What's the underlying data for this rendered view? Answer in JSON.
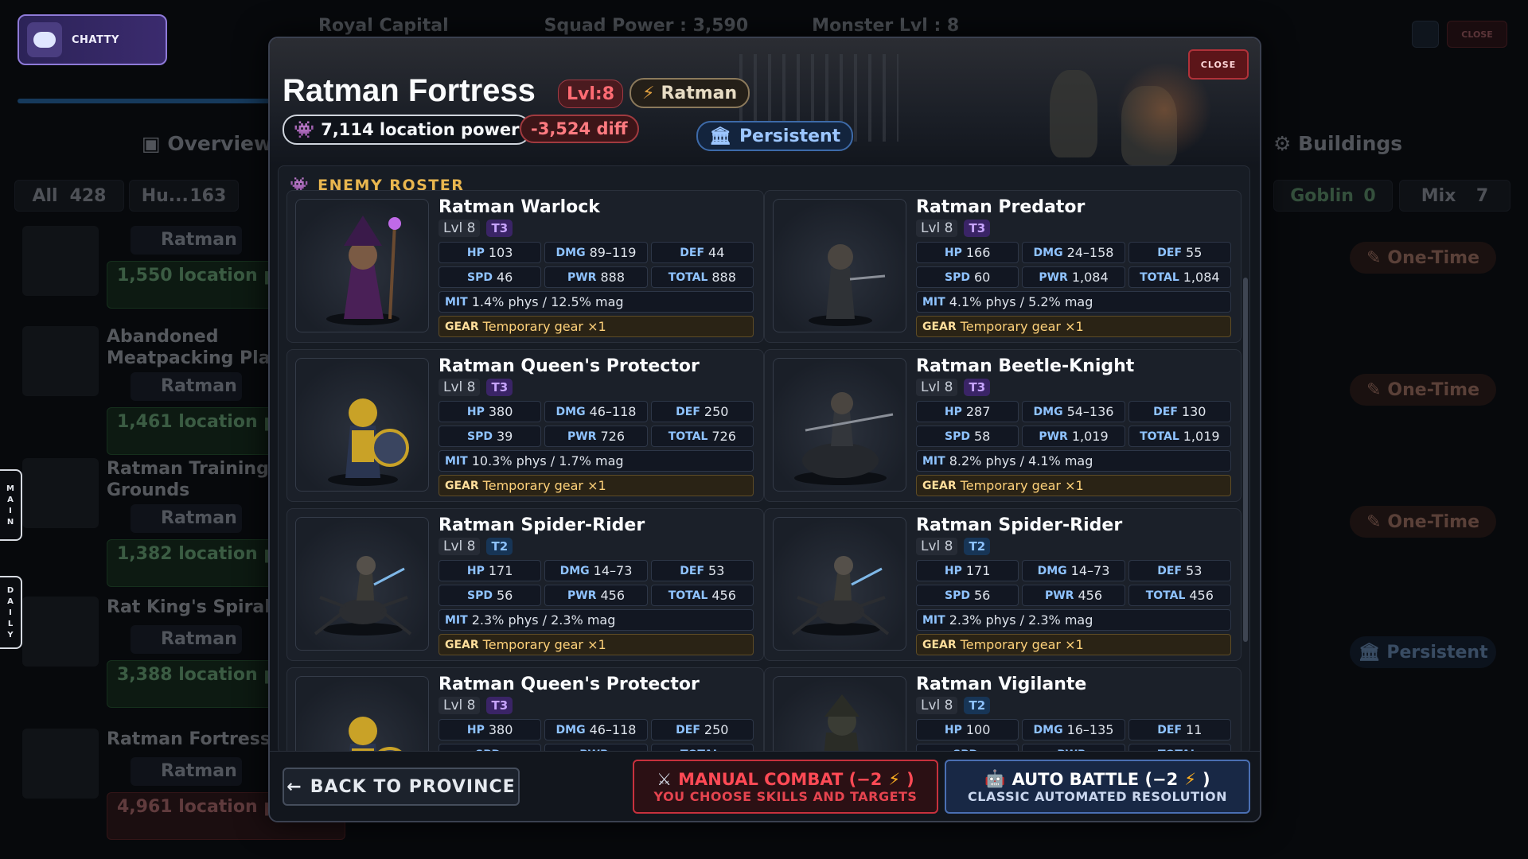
{
  "chat": {
    "label": "CHATTY"
  },
  "background": {
    "top": {
      "capital": "Royal Capital",
      "squad_power": "Squad Power : 3,590",
      "monster_lvl": "Monster Lvl : 8"
    },
    "tabs": {
      "overview": "Overview",
      "buildings": "Buildings"
    },
    "filters": [
      {
        "label": "All",
        "count": "428"
      },
      {
        "label": "Hu...",
        "count": "163"
      },
      {
        "label": "Goblin",
        "count": "0"
      },
      {
        "label": "Mix",
        "count": "7"
      }
    ],
    "locations": [
      {
        "name": "",
        "faction": "Ratman",
        "power": "1,550 location power",
        "tag": "One-Time"
      },
      {
        "name": "Abandoned Meatpacking Plant",
        "faction": "Ratman",
        "power": "1,461 location power",
        "tag": "One-Time"
      },
      {
        "name": "Ratman Training Grounds",
        "faction": "Ratman",
        "power": "1,382 location power",
        "tag": "One-Time"
      },
      {
        "name": "Rat King's Spiral",
        "faction": "Ratman",
        "power": "3,388 location power",
        "tag": "Persistent"
      },
      {
        "name": "Ratman Fortress",
        "faction": "Ratman",
        "power": "4,961 location power",
        "tag": ""
      }
    ],
    "side_tabs": {
      "main": [
        "M",
        "A",
        "I",
        "N"
      ],
      "daily": [
        "D",
        "A",
        "I",
        "L",
        "Y"
      ]
    },
    "window": {
      "close_label": "CLOSE"
    }
  },
  "modal": {
    "title": "Ratman Fortress",
    "level": "Lvl:8",
    "faction": "Ratman",
    "location_power": "7,114 location power",
    "diff": "-3,524 diff",
    "persistence": "Persistent",
    "close_label": "CLOSE",
    "roster_heading": "ENEMY ROSTER",
    "labels": {
      "hp": "HP",
      "dmg": "DMG",
      "def": "DEF",
      "spd": "SPD",
      "pwr": "PWR",
      "total": "TOTAL",
      "mit": "MIT",
      "gear": "GEAR"
    },
    "units": [
      {
        "name": "Ratman Warlock",
        "level": "Lvl 8",
        "tier": "T3",
        "hp": "103",
        "dmg": "89–119",
        "def": "44",
        "spd": "46",
        "pwr": "888",
        "total": "888",
        "mit": "1.4% phys / 12.5% mag",
        "gear": "Temporary gear ×1",
        "art": "warlock"
      },
      {
        "name": "Ratman Predator",
        "level": "Lvl 8",
        "tier": "T3",
        "hp": "166",
        "dmg": "24–158",
        "def": "55",
        "spd": "60",
        "pwr": "1,084",
        "total": "1,084",
        "mit": "4.1% phys / 5.2% mag",
        "gear": "Temporary gear ×1",
        "art": "predator"
      },
      {
        "name": "Ratman Queen's Protector",
        "level": "Lvl 8",
        "tier": "T3",
        "hp": "380",
        "dmg": "46–118",
        "def": "250",
        "spd": "39",
        "pwr": "726",
        "total": "726",
        "mit": "10.3% phys / 1.7% mag",
        "gear": "Temporary gear ×1",
        "art": "protector"
      },
      {
        "name": "Ratman Beetle-Knight",
        "level": "Lvl 8",
        "tier": "T3",
        "hp": "287",
        "dmg": "54–136",
        "def": "130",
        "spd": "58",
        "pwr": "1,019",
        "total": "1,019",
        "mit": "8.2% phys / 4.1% mag",
        "gear": "Temporary gear ×1",
        "art": "beetle"
      },
      {
        "name": "Ratman Spider-Rider",
        "level": "Lvl 8",
        "tier": "T2",
        "hp": "171",
        "dmg": "14–73",
        "def": "53",
        "spd": "56",
        "pwr": "456",
        "total": "456",
        "mit": "2.3% phys / 2.3% mag",
        "gear": "Temporary gear ×1",
        "art": "spider"
      },
      {
        "name": "Ratman Spider-Rider",
        "level": "Lvl 8",
        "tier": "T2",
        "hp": "171",
        "dmg": "14–73",
        "def": "53",
        "spd": "56",
        "pwr": "456",
        "total": "456",
        "mit": "2.3% phys / 2.3% mag",
        "gear": "Temporary gear ×1",
        "art": "spider"
      },
      {
        "name": "Ratman Queen's Protector",
        "level": "Lvl 8",
        "tier": "T3",
        "hp": "380",
        "dmg": "46–118",
        "def": "250",
        "spd": "",
        "pwr": "",
        "total": "",
        "mit": "",
        "gear": "",
        "art": "protector"
      },
      {
        "name": "Ratman Vigilante",
        "level": "Lvl 8",
        "tier": "T2",
        "hp": "100",
        "dmg": "16–135",
        "def": "11",
        "spd": "",
        "pwr": "",
        "total": "",
        "mit": "",
        "gear": "",
        "art": "vigilante"
      }
    ],
    "footer": {
      "back": "BACK TO PROVINCE",
      "manual_title": "MANUAL COMBAT (−2",
      "manual_close": ")",
      "manual_sub": "YOU CHOOSE SKILLS AND TARGETS",
      "auto_title": "AUTO BATTLE (−2",
      "auto_close": ")",
      "auto_sub": "CLASSIC AUTOMATED RESOLUTION"
    }
  }
}
